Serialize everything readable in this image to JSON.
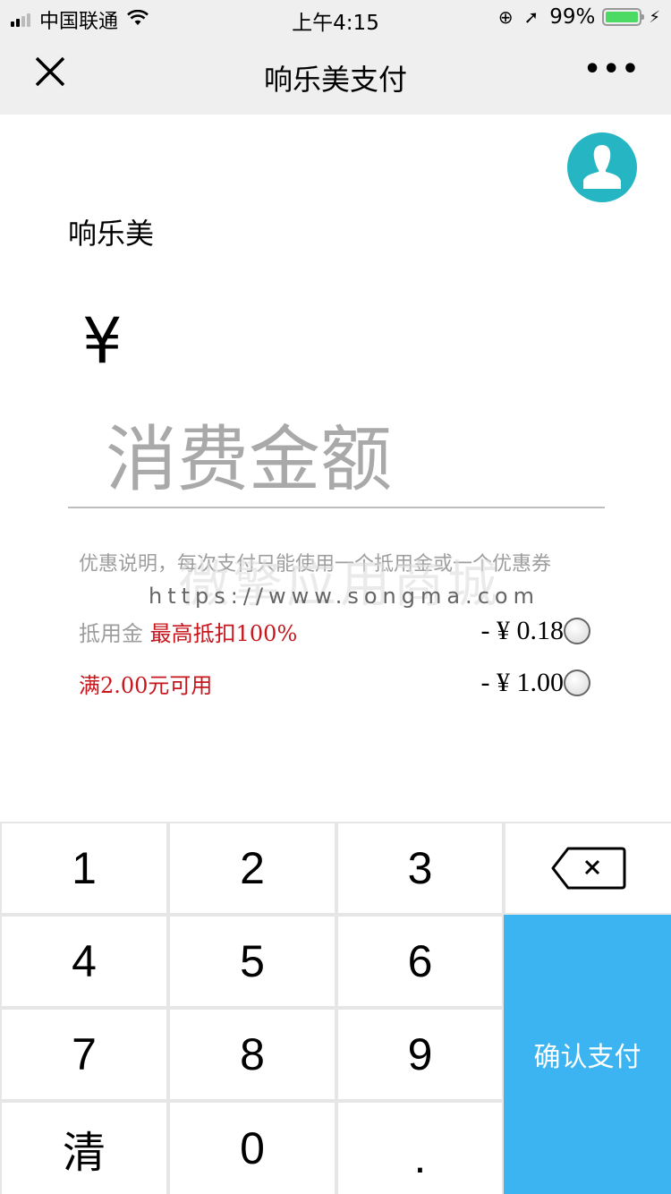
{
  "status_bar": {
    "carrier": "中国联通",
    "time": "上午4:15",
    "battery": "99%",
    "icons": [
      "signal-icon",
      "wifi-icon",
      "orientation-lock-icon",
      "location-icon",
      "battery-icon",
      "charging-icon"
    ]
  },
  "nav": {
    "title": "响乐美支付",
    "close_icon": "close-icon",
    "more_label": "•••"
  },
  "merchant": {
    "name": "响乐美",
    "avatar_icon": "user-avatar-icon"
  },
  "amount": {
    "currency_symbol": "¥",
    "placeholder": "消费金额",
    "value": ""
  },
  "discount": {
    "note": "优惠说明，每次支付只能使用一个抵用金或一个优惠券",
    "watermark_url": "https://www.songma.com",
    "watermark_text": "微擎应用商城",
    "options": [
      {
        "label": "抵用金",
        "highlight": "最高抵扣100%",
        "amount": "- ¥ 0.18",
        "selected": false
      },
      {
        "label": "",
        "highlight": "满2.00元可用",
        "amount": "- ¥ 1.00",
        "selected": false
      }
    ]
  },
  "keypad": {
    "keys": [
      "1",
      "2",
      "3",
      "4",
      "5",
      "6",
      "7",
      "8",
      "9",
      "清",
      "0",
      "."
    ],
    "backspace_icon": "backspace-icon",
    "confirm_label": "确认支付",
    "confirm_color": "#3db4f2"
  }
}
